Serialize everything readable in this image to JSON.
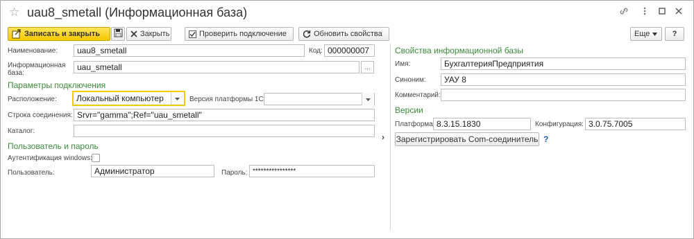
{
  "window": {
    "title": "uau8_smetall (Информационная база)"
  },
  "toolbar": {
    "save_close_label": "Записать и закрыть",
    "close_label": "Закрыть",
    "check_connection_label": "Проверить подключение",
    "refresh_props_label": "Обновить свойства",
    "more_label": "Еще",
    "help_label": "?"
  },
  "left": {
    "name_label": "Наименование:",
    "name_value": "uau8_smetall",
    "code_label": "Код:",
    "code_value": "000000007",
    "infobase_label_1": "Информационная",
    "infobase_label_2": "база:",
    "infobase_value": "uau_smetall",
    "infobase_select": "...",
    "conn_section": "Параметры подключения",
    "location_label": "Расположение:",
    "location_value": "Локальный компьютер",
    "platform_version_label": "Версия платформы 1С:",
    "platform_version_value": "",
    "conn_string_label": "Строка соединения:",
    "conn_string_value": "Srvr=\"gamma\";Ref=\"uau_smetall\"",
    "catalog_label": "Каталог:",
    "catalog_value": "",
    "user_section": "Пользователь и пароль",
    "win_auth_label": "Аутентификация windows:",
    "user_label": "Пользователь:",
    "user_value": "Администратор",
    "password_label": "Пароль:",
    "password_value": "****************"
  },
  "right": {
    "props_section": "Свойства информационной базы",
    "name_label": "Имя:",
    "name_value": "БухгалтерияПредприятия",
    "synonym_label": "Синоним:",
    "synonym_value": "УАУ 8",
    "comment_label": "Комментарий:",
    "comment_value": "",
    "versions_section": "Версии",
    "platform_label": "Платформа:",
    "platform_value": "8.3.15.1830",
    "config_label": "Конфигурация:",
    "config_value": "3.0.75.7005",
    "register_com_label": "Зарегистрировать Com-соединитель"
  },
  "colors": {
    "accent_yellow": "#f6c800",
    "section_green": "#3a8a3a",
    "help_blue": "#1a5fb4"
  }
}
